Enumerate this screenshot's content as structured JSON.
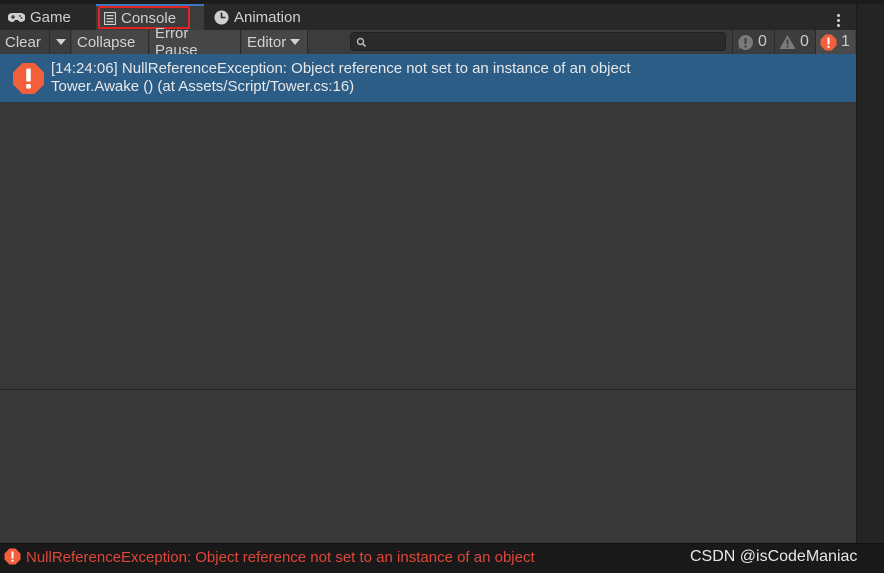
{
  "tabs": [
    {
      "label": "Game",
      "icon": "gamepad-icon"
    },
    {
      "label": "Console",
      "icon": "console-icon",
      "active": true
    },
    {
      "label": "Animation",
      "icon": "clock-icon"
    }
  ],
  "toolbar": {
    "clear_label": "Clear",
    "collapse_label": "Collapse",
    "error_pause_label": "Error Pause",
    "editor_label": "Editor",
    "search_placeholder": "",
    "info_count": "0",
    "warning_count": "0",
    "error_count": "1"
  },
  "log": {
    "entries": [
      {
        "type": "error",
        "line1": "[14:24:06] NullReferenceException: Object reference not set to an instance of an object",
        "line2": "Tower.Awake () (at Assets/Script/Tower.cs:16)",
        "selected": true
      }
    ]
  },
  "status": {
    "message": "NullReferenceException: Object reference not set to an instance of an object"
  },
  "watermark": "CSDN @isCodeManiac",
  "colors": {
    "error": "#f25f3a",
    "selected_row": "#2c5d87",
    "highlight_box": "#e02424",
    "panel": "#383838"
  }
}
